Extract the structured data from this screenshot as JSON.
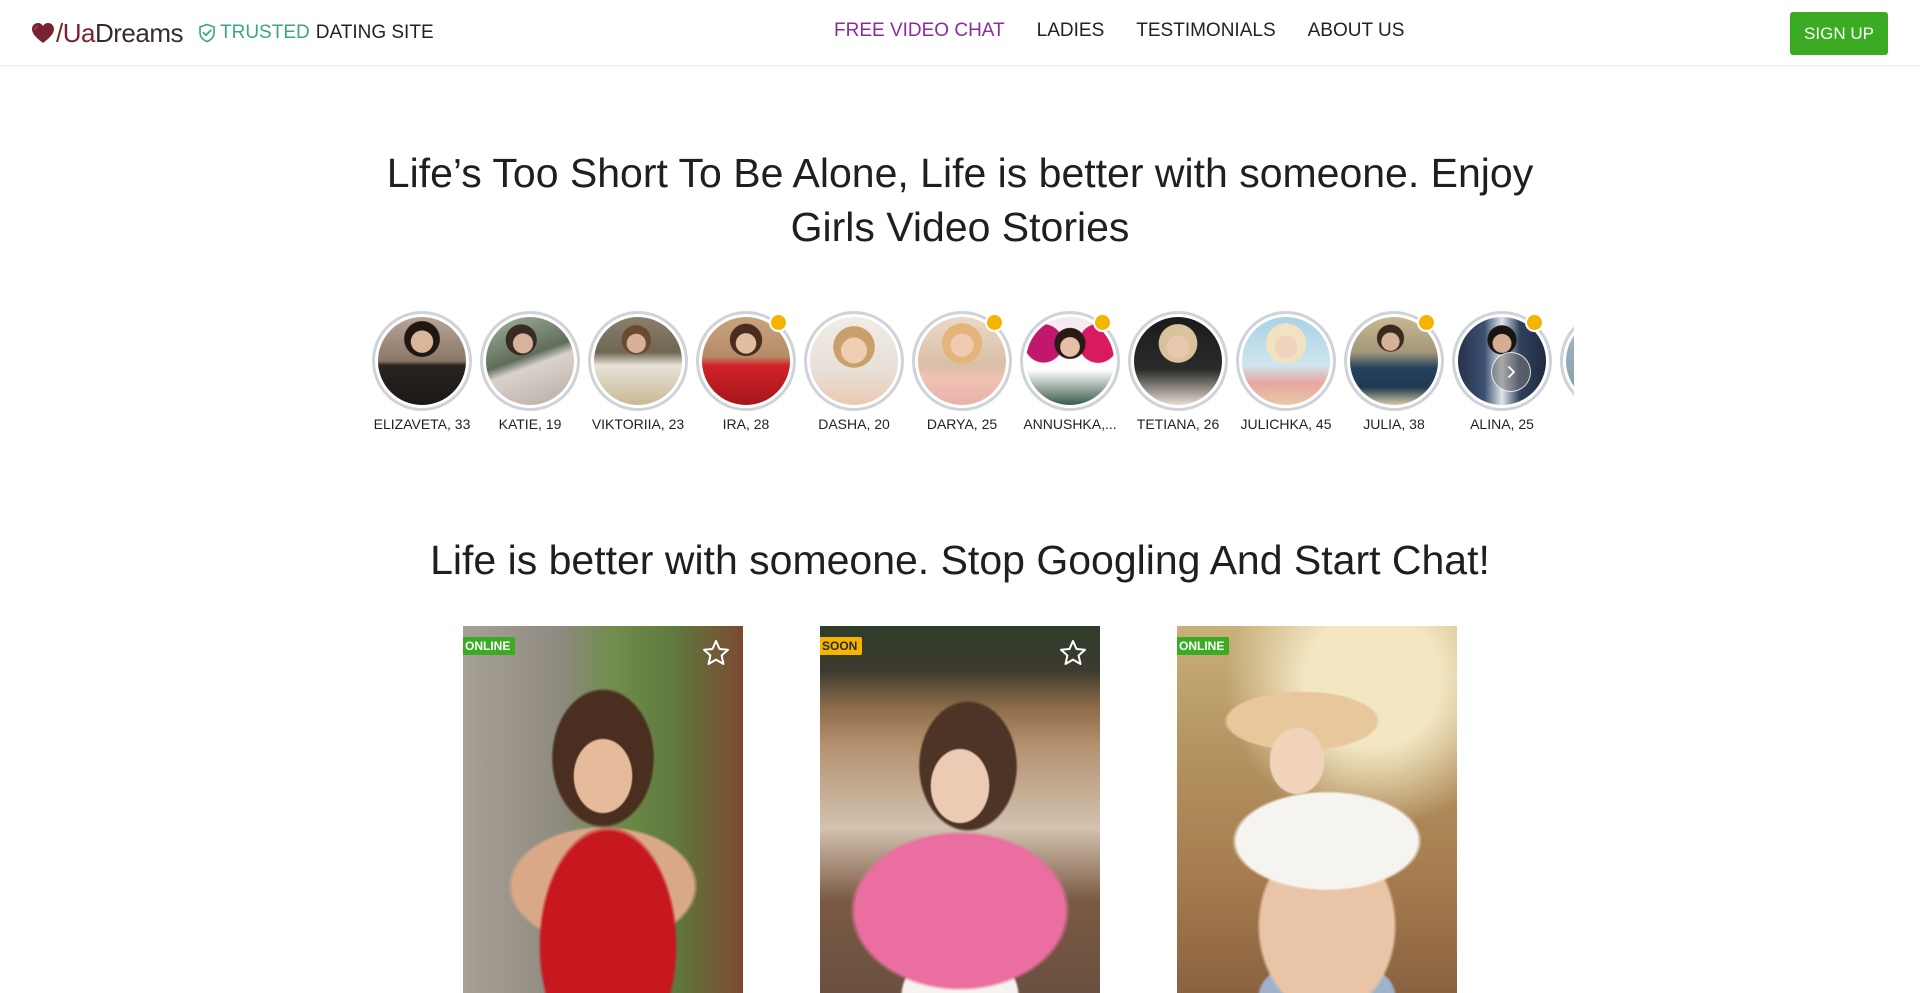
{
  "header": {
    "logo": {
      "prefix": "/",
      "brand_ua": "Ua",
      "brand_rest": "Dreams"
    },
    "trusted": {
      "word1": "TRUSTED",
      "word2": "DATING SITE"
    },
    "nav": [
      {
        "label": "FREE VIDEO CHAT",
        "active": true
      },
      {
        "label": "LADIES",
        "active": false
      },
      {
        "label": "TESTIMONIALS",
        "active": false
      },
      {
        "label": "ABOUT US",
        "active": false
      }
    ],
    "signup_label": "SIGN UP"
  },
  "headline_1": "Life’s Too Short To Be Alone, Life is better with someone. Enjoy Girls Video Stories",
  "stories": [
    {
      "name": "ELIZAVETA, 33",
      "has_dot": false
    },
    {
      "name": "KATIE, 19",
      "has_dot": false
    },
    {
      "name": "VIKTORIIA, 23",
      "has_dot": false
    },
    {
      "name": "IRA, 28",
      "has_dot": true
    },
    {
      "name": "DASHA, 20",
      "has_dot": false
    },
    {
      "name": "DARYA, 25",
      "has_dot": true
    },
    {
      "name": "ANNUSHKA,...",
      "has_dot": true
    },
    {
      "name": "TETIANA, 26",
      "has_dot": false
    },
    {
      "name": "JULICHKA, 45",
      "has_dot": false
    },
    {
      "name": "JULIA, 38",
      "has_dot": true
    },
    {
      "name": "ALINA, 25",
      "has_dot": true
    },
    {
      "name": "",
      "has_dot": false
    }
  ],
  "headline_2": "Life is better with someone. Stop Googling And Start Chat!",
  "cards": [
    {
      "status": "ONLINE",
      "status_type": "online",
      "favorite_icon": "star-outline-icon"
    },
    {
      "status": "SOON",
      "status_type": "soon",
      "favorite_icon": "star-outline-icon"
    },
    {
      "status": "ONLINE",
      "status_type": "online",
      "favorite_icon": "none"
    }
  ],
  "colors": {
    "nav_active": "#8a2d9d",
    "signup_bg": "#3aab22",
    "trusted": "#3aa58a",
    "online_badge": "#3aab22",
    "soon_badge": "#f4b400",
    "story_dot": "#f4b400",
    "logo_heart": "#7a2230"
  }
}
